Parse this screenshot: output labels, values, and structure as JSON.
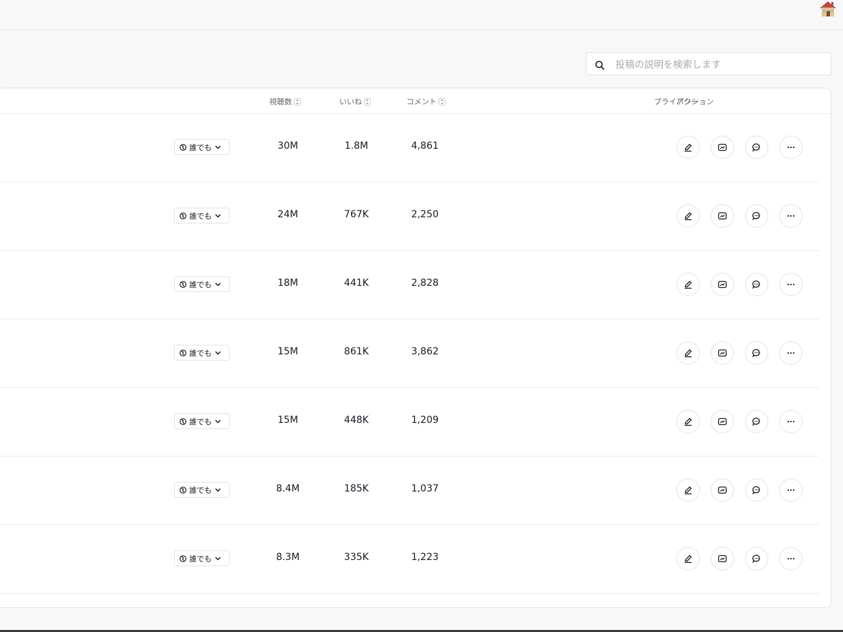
{
  "search": {
    "placeholder": "投稿の説明を検索します"
  },
  "table": {
    "headers": {
      "privacy": "プライバシー",
      "views": "視聴数",
      "likes": "いいね",
      "comments": "コメント",
      "actions": "アクション"
    },
    "rows": [
      {
        "privacy": "誰でも",
        "views": "30M",
        "likes": "1.8M",
        "comments": "4,861"
      },
      {
        "privacy": "誰でも",
        "views": "24M",
        "likes": "767K",
        "comments": "2,250"
      },
      {
        "privacy": "誰でも",
        "views": "18M",
        "likes": "441K",
        "comments": "2,828"
      },
      {
        "privacy": "誰でも",
        "views": "15M",
        "likes": "861K",
        "comments": "3,862"
      },
      {
        "privacy": "誰でも",
        "views": "15M",
        "likes": "448K",
        "comments": "1,209"
      },
      {
        "privacy": "誰でも",
        "views": "8.4M",
        "likes": "185K",
        "comments": "1,037"
      },
      {
        "privacy": "誰でも",
        "views": "8.3M",
        "likes": "335K",
        "comments": "1,223"
      }
    ]
  },
  "icons": {
    "avatar": "house-avatar-icon",
    "search": "search-icon",
    "privacy": "globe-icon",
    "dropdown": "chevron-down-icon",
    "actions": [
      "edit-icon",
      "image-icon",
      "comment-icon",
      "more-icon"
    ]
  }
}
